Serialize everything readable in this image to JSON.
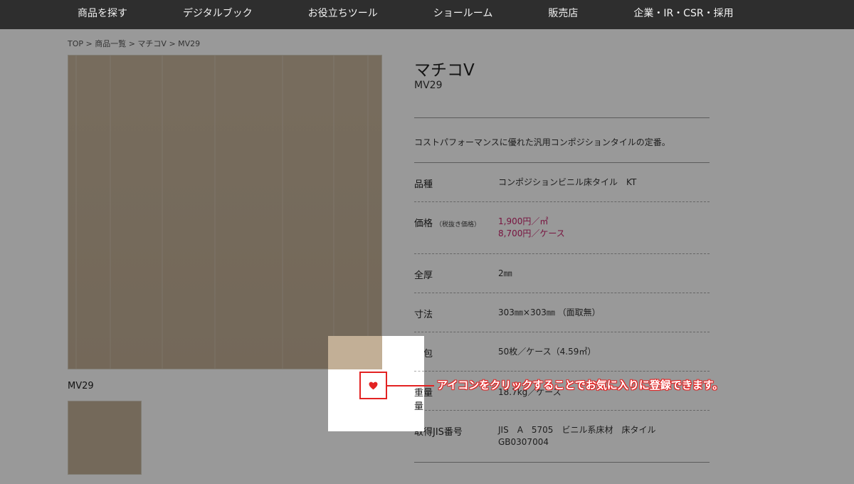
{
  "nav": {
    "items": [
      "商品を探す",
      "デジタルブック",
      "お役立ちツール",
      "ショールーム",
      "販売店",
      "企業・IR・CSR・採用"
    ]
  },
  "breadcrumb": "TOP > 商品一覧 > マチコV > MV29",
  "product": {
    "name": "マチコV",
    "code": "MV29",
    "description": "コストパフォーマンスに優れた汎用コンポジションタイルの定番。",
    "swatch_caption": "MV29",
    "swatch_color": "#c2af96"
  },
  "specs": {
    "type_label": "品種",
    "type_value": "コンポジションビニル床タイル　KT",
    "price_label": "価格",
    "price_note": "（税抜き価格）",
    "price_line1": "1,900円／㎡",
    "price_line2": "8,700円／ケース",
    "thickness_label": "全厚",
    "thickness_value": "2㎜",
    "size_label": "寸法",
    "size_value": "303㎜×303㎜ （面取無）",
    "pack_label": "梱包",
    "pack_value": "50枚／ケース（4.59㎡）",
    "weight_label": "重量",
    "weight_value": "18.7kg／ケース",
    "jis_label": "取得JIS番号",
    "jis_line1": "JIS　A　5705　ビニル系床材　床タイル",
    "jis_line2": "GB0307004"
  },
  "overlay": {
    "callout": "アイコンをクリックすることでお気に入りに登録できます。",
    "icon": "heart-icon",
    "accent_color": "#e32222",
    "price_color": "#c8246c"
  }
}
